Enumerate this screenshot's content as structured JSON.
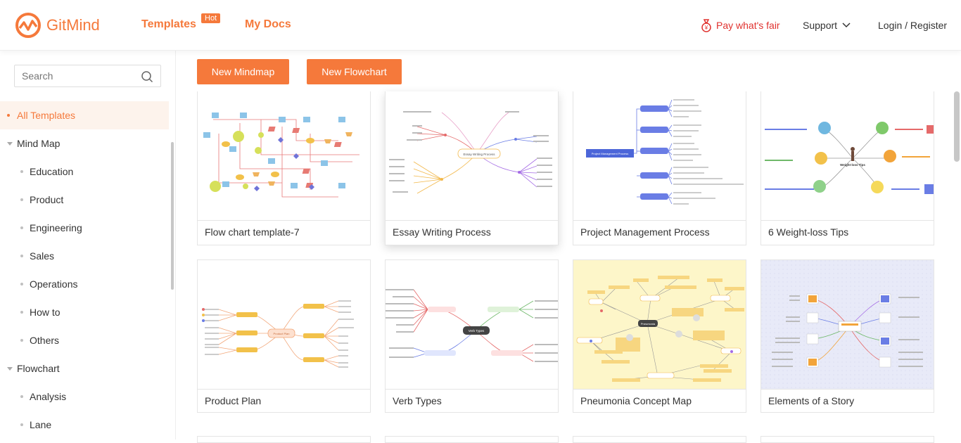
{
  "header": {
    "logo_text": "GitMind",
    "nav": {
      "templates": "Templates",
      "hot_badge": "Hot",
      "my_docs": "My Docs"
    },
    "pay": "Pay what's fair",
    "support": "Support",
    "login": "Login / Register"
  },
  "sidebar": {
    "search_placeholder": "Search",
    "items": [
      {
        "label": "All Templates",
        "level": 0,
        "active": true
      },
      {
        "label": "Mind Map",
        "level": 0,
        "expandable": true
      },
      {
        "label": "Education",
        "level": 1
      },
      {
        "label": "Product",
        "level": 1
      },
      {
        "label": "Engineering",
        "level": 1
      },
      {
        "label": "Sales",
        "level": 1
      },
      {
        "label": "Operations",
        "level": 1
      },
      {
        "label": "How to",
        "level": 1
      },
      {
        "label": "Others",
        "level": 1
      },
      {
        "label": "Flowchart",
        "level": 0,
        "expandable": true
      },
      {
        "label": "Analysis",
        "level": 1
      },
      {
        "label": "Lane",
        "level": 1
      }
    ]
  },
  "toolbar": {
    "new_mindmap": "New Mindmap",
    "new_flowchart": "New Flowchart"
  },
  "templates": [
    {
      "title": "Flow chart template-7"
    },
    {
      "title": "Essay Writing Process",
      "thumb_center": "Essay Writing Process"
    },
    {
      "title": "Project Management Process",
      "thumb_center": "Project Management Process"
    },
    {
      "title": "6 Weight-loss Tips",
      "thumb_center": "Weight-loss Tips"
    },
    {
      "title": "Product Plan",
      "thumb_center": "Product Plan"
    },
    {
      "title": "Verb Types",
      "thumb_center": "Verb Types"
    },
    {
      "title": "Pneumonia Concept Map",
      "thumb_center": "Pneumonia"
    },
    {
      "title": "Elements of a Story"
    }
  ],
  "colors": {
    "accent": "#f5793b",
    "pay": "#e0322f",
    "active_bg": "#fdf3ec"
  }
}
